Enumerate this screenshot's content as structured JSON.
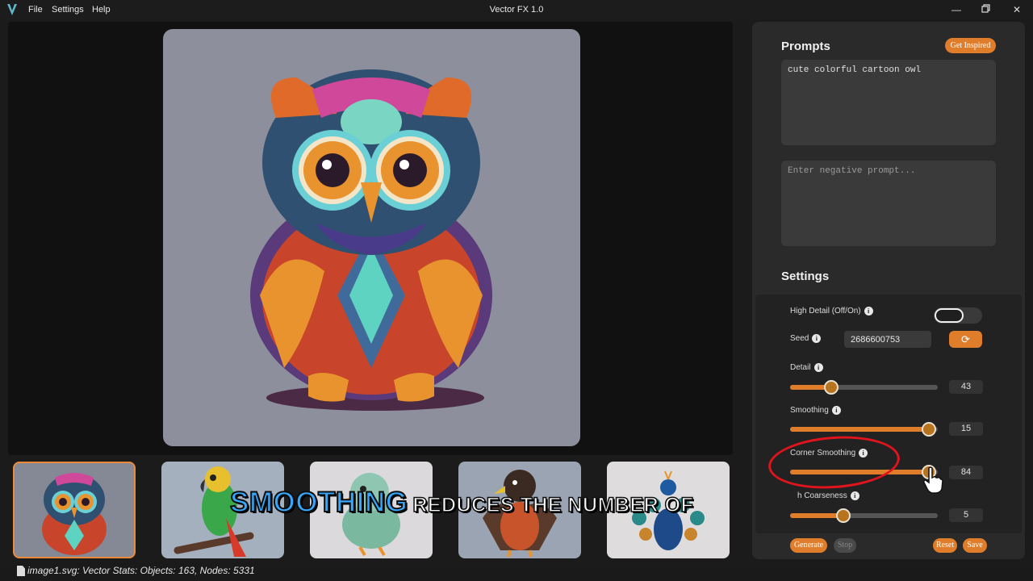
{
  "titlebar": {
    "title": "Vector FX 1.0",
    "menu": [
      "File",
      "Settings",
      "Help"
    ],
    "controls": {
      "minimize": "minimize-icon",
      "maximize": "restore-icon",
      "close": "close-icon"
    }
  },
  "gallery": {
    "selected_index": 0,
    "items": [
      "owl",
      "parrot",
      "bird",
      "eagle",
      "peacock"
    ]
  },
  "prompts": {
    "heading": "Prompts",
    "inspire_label": "Get Inspired",
    "prompt_value": "cute colorful cartoon owl",
    "negative_placeholder": "Enter negative prompt..."
  },
  "settings": {
    "heading": "Settings",
    "high_detail_label": "High Detail (Off/On)",
    "high_detail_on": false,
    "seed_label": "Seed",
    "seed_value": "2686600753",
    "detail_label": "Detail",
    "detail_value": "43",
    "detail_level": 0.28,
    "smoothing_label": "Smoothing",
    "smoothing_value": "15",
    "smoothing_level": 0.94,
    "corner_label": "Corner Smoothing",
    "corner_value": "84",
    "corner_level": 0.94,
    "coarse_label": "h Coarseness",
    "coarse_value": "5",
    "coarse_level": 0.36
  },
  "actions": {
    "generate": "Generate",
    "stop": "Stop",
    "reset": "Reset",
    "save": "Save"
  },
  "status": {
    "text": "image1.svg: Vector Stats: Objects: 163, Nodes: 5331"
  },
  "caption": {
    "highlight": "SMOOTHING",
    "rest": "REDUCES THE NUMBER OF"
  },
  "colors": {
    "accent": "#e07d2b",
    "annotation": "#e0141c",
    "caption_highlight": "#37a8ff"
  }
}
